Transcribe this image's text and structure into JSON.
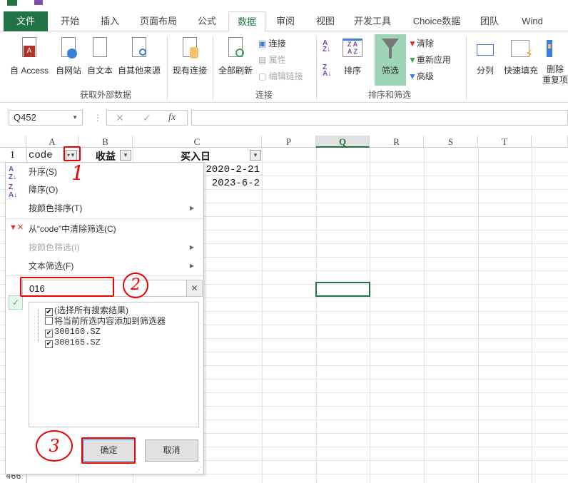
{
  "tabs": [
    "文件",
    "开始",
    "插入",
    "页面布局",
    "公式",
    "数据",
    "审阅",
    "视图",
    "开发工具",
    "Choice数据",
    "团队",
    "Wind"
  ],
  "ribbon": {
    "get_external": {
      "buttons": [
        "自 Access",
        "自网站",
        "自文本",
        "自其他来源"
      ],
      "label": "获取外部数据"
    },
    "existing": "现有连接",
    "connections": {
      "refresh": "全部刷新",
      "items": [
        "连接",
        "属性",
        "编辑链接"
      ],
      "label": "连接"
    },
    "sort_filter": {
      "sort": "排序",
      "filter": "筛选",
      "items": [
        "清除",
        "重新应用",
        "高级"
      ],
      "label": "排序和筛选"
    },
    "tools": [
      "分列",
      "快速填充",
      "删除",
      "重复项"
    ]
  },
  "formula_bar": {
    "name_box": "Q452",
    "cancel": "✕",
    "enter": "✓",
    "fx": "fx",
    "value": ""
  },
  "columns": [
    "A",
    "B",
    "C",
    "P",
    "Q",
    "R",
    "S",
    "T"
  ],
  "rows": {
    "row1": "1",
    "last": "466"
  },
  "headers": {
    "a": "code",
    "b": "收益",
    "c": "买入日"
  },
  "cells": {
    "c2": "2020-2-21",
    "c3": "2023-6-2"
  },
  "menu": {
    "items": [
      "升序(S)",
      "降序(O)",
      "按颜色排序(T)",
      "从“code”中清除筛选(C)",
      "按颜色筛选(I)",
      "文本筛选(F)"
    ],
    "search_value": "016",
    "list": [
      {
        "label": "(选择所有搜索结果)",
        "checked": true
      },
      {
        "label": "将当前所选内容添加到筛选器",
        "checked": false
      },
      {
        "label": "300160.SZ",
        "checked": true
      },
      {
        "label": "300165.SZ",
        "checked": true
      }
    ],
    "ok": "确定",
    "cancel": "取消"
  },
  "annotations": [
    "1",
    "2",
    "3"
  ]
}
